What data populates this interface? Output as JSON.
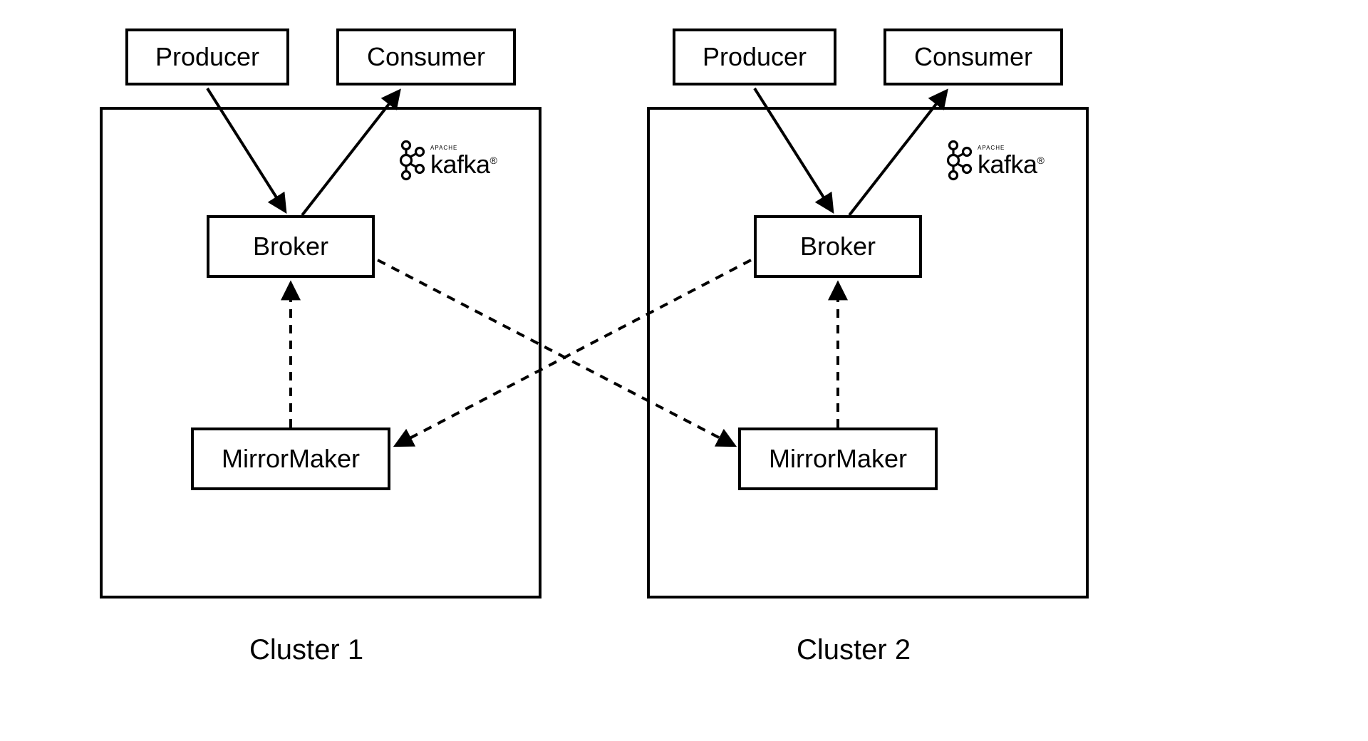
{
  "diagram": {
    "clusters": [
      {
        "label": "Cluster 1",
        "producer": "Producer",
        "consumer": "Consumer",
        "broker": "Broker",
        "mirrormaker": "MirrorMaker",
        "logo_brand": "kafka",
        "logo_tag": "APACHE",
        "logo_reg": "®"
      },
      {
        "label": "Cluster 2",
        "producer": "Producer",
        "consumer": "Consumer",
        "broker": "Broker",
        "mirrormaker": "MirrorMaker",
        "logo_brand": "kafka",
        "logo_tag": "APACHE",
        "logo_reg": "®"
      }
    ],
    "arrows": {
      "producer_to_broker": "solid",
      "broker_to_consumer": "solid",
      "mirrormaker_to_broker": "dashed",
      "cross_cluster": "dashed"
    }
  }
}
